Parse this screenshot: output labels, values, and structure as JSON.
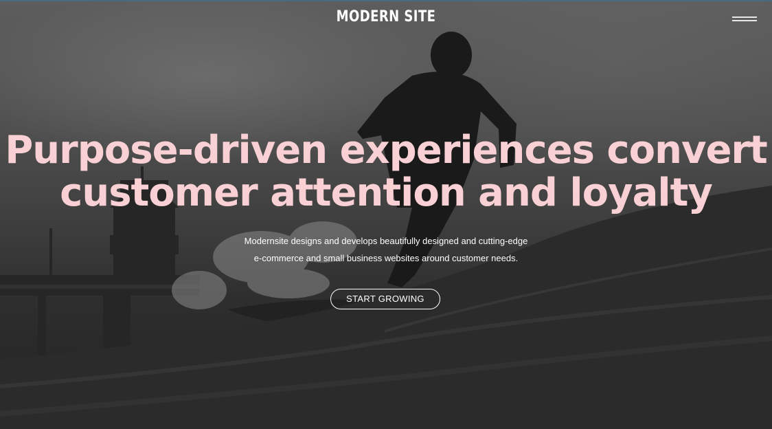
{
  "header": {
    "logo_text": "MODERN SITE",
    "menu_icon": "hamburger-menu-icon"
  },
  "hero": {
    "headline_line1": "Purpose-driven experiences convert",
    "headline_line2": "customer attention and loyalty",
    "subtext_line1": "Modernsite designs and develops beautifully designed and cutting-edge",
    "subtext_line2": "e-commerce and small business websites around customer needs.",
    "cta_label": "START GROWING"
  },
  "colors": {
    "headline": "#f9d0d4",
    "text": "#ffffff",
    "top_border": "#4a6a80"
  }
}
